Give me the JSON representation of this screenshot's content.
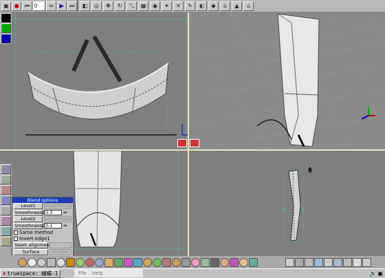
{
  "app": {
    "title": "truespace: 蝴蝶-1"
  },
  "toolbar": {
    "frame_value": "0"
  },
  "taskbar": {
    "menu_file": "File",
    "menu_help": "Help"
  },
  "blend_panel": {
    "title": "Blend options",
    "level1_label": "Level1",
    "smoothness_header_1": "smoothness",
    "smoothness1_label": "Smoothness1",
    "smoothness1_value": "0.3",
    "level2_label": "Level2",
    "smoothness_header_2": "smoothness",
    "smoothness2_label": "Smoothness2",
    "smoothness2_value": "0.1",
    "same_method_label": "Same method",
    "invert_edge_label": "Invert edge1",
    "seam_alignment_label": "Seam alignment",
    "surface_label": "Surface",
    "simpler_label": "simpler"
  },
  "colors": {
    "viewport_bg": "#7f7f7f",
    "grid": "#5fa89a",
    "title_bar": "#1e3cb4",
    "divider": "#e8e8c0"
  }
}
